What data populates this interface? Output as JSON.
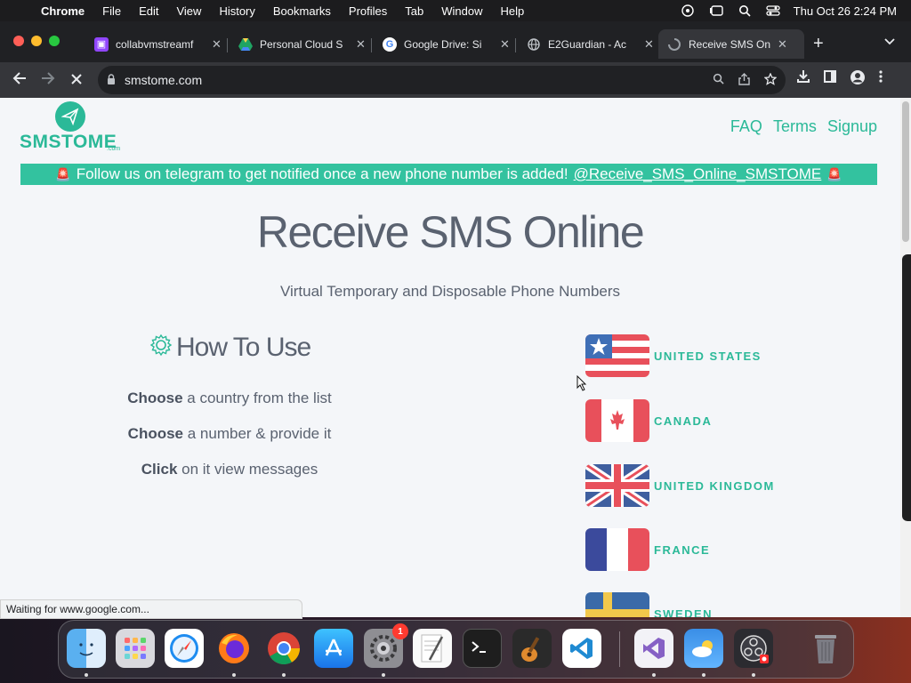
{
  "menubar": {
    "apple": "",
    "app": "Chrome",
    "items": [
      "File",
      "Edit",
      "View",
      "History",
      "Bookmarks",
      "Profiles",
      "Tab",
      "Window",
      "Help"
    ],
    "clock": "Thu Oct 26  2:24 PM"
  },
  "tabs": [
    {
      "title": "collabvmstreamf",
      "icon": "twitch-icon",
      "color": "#9146ff"
    },
    {
      "title": "Personal Cloud S",
      "icon": "google-drive-icon",
      "color": "#1fa463"
    },
    {
      "title": "Google Drive: Si",
      "icon": "google-icon",
      "color": "#4285f4"
    },
    {
      "title": "E2Guardian - Ac",
      "icon": "globe-icon",
      "color": "#9aa0a6"
    },
    {
      "title": "Receive SMS On",
      "icon": "loading-icon",
      "color": "#9aa0a6"
    }
  ],
  "toolbar": {
    "url": "smstome.com"
  },
  "site": {
    "logo_text": "SMSTOME",
    "logo_sub": ".com",
    "nav": [
      "FAQ",
      "Terms",
      "Signup"
    ],
    "banner_text": "Follow us on telegram to get notified once a new phone number is added!",
    "banner_link": "@Receive_SMS_Online_SMSTOME",
    "title": "Receive SMS Online",
    "subtitle": "Virtual Temporary and Disposable Phone Numbers",
    "howto_title": "How To Use",
    "steps": [
      {
        "bold": "Choose",
        "rest": " a country from the list"
      },
      {
        "bold": "Choose",
        "rest": " a number & provide it"
      },
      {
        "bold": "Click",
        "rest": " on it view messages"
      }
    ],
    "countries": [
      "UNITED STATES",
      "CANADA",
      "UNITED KINGDOM",
      "FRANCE",
      "SWEDEN"
    ]
  },
  "status": {
    "text": "Waiting for www.google.com..."
  },
  "dock": {
    "apps": [
      {
        "name": "Finder",
        "icon": "finder-icon"
      },
      {
        "name": "Launchpad",
        "icon": "launchpad-icon"
      },
      {
        "name": "Safari",
        "icon": "safari-icon"
      },
      {
        "name": "Firefox",
        "icon": "firefox-icon"
      },
      {
        "name": "Chrome",
        "icon": "chrome-icon"
      },
      {
        "name": "App Store",
        "icon": "app-store-icon"
      },
      {
        "name": "System Settings",
        "icon": "settings-icon",
        "badge": "1"
      },
      {
        "name": "TextEdit",
        "icon": "textedit-icon"
      },
      {
        "name": "Terminal",
        "icon": "terminal-icon"
      },
      {
        "name": "GarageBand",
        "icon": "garageband-icon"
      },
      {
        "name": "VS Code",
        "icon": "vscode-icon"
      },
      {
        "name": "Visual Studio",
        "icon": "visual-studio-icon"
      },
      {
        "name": "Weather",
        "icon": "weather-icon"
      },
      {
        "name": "OBS",
        "icon": "obs-icon"
      },
      {
        "name": "Trash",
        "icon": "trash-icon"
      }
    ]
  },
  "colors": {
    "accent": "#2bb998",
    "banner": "#33c29f",
    "text": "#5a6270"
  }
}
